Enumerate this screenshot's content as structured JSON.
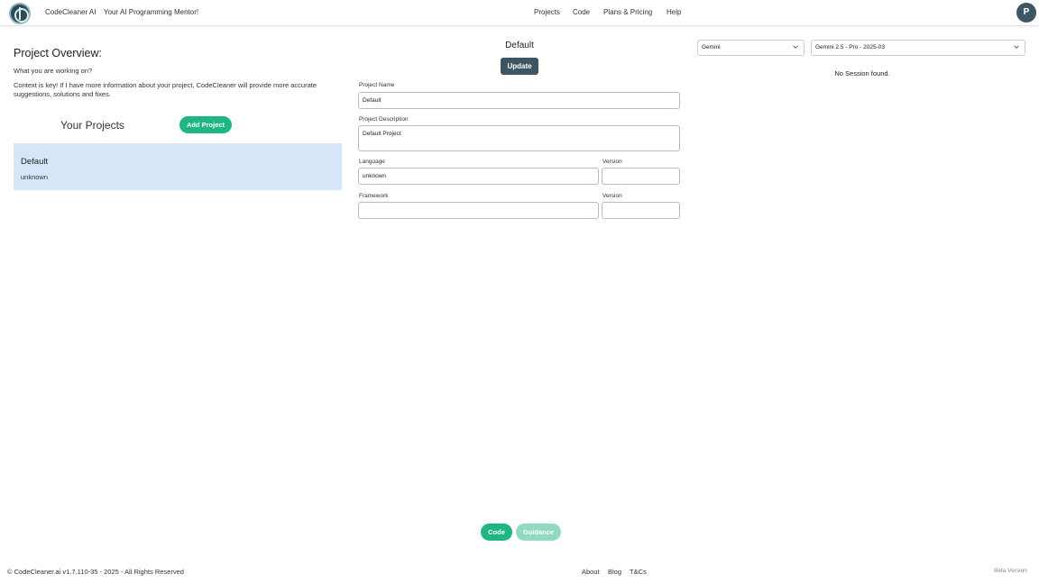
{
  "header": {
    "brand": "CodeCleaner AI",
    "tagline": "Your AI Programming Mentor!",
    "nav": [
      "Projects",
      "Code",
      "Plans & Pricing",
      "Help"
    ],
    "avatar_initial": "P"
  },
  "overview": {
    "title": "Project Overview:",
    "subtitle": "What you are working on?",
    "text": "Context is key! If I have more information about your project, CodeCleaner will provide more accurate suggestions, solutions and fixes."
  },
  "projects": {
    "heading": "Your Projects",
    "add_label": "Add Project",
    "items": [
      {
        "name": "Default",
        "language": "unknown"
      }
    ]
  },
  "form": {
    "title": "Default",
    "update_label": "Update",
    "project_name_label": "Project Name",
    "project_name_value": "Default",
    "description_label": "Project Description",
    "description_value": "Default Project",
    "language_label": "Language",
    "language_value": "unknown",
    "language_version_label": "Version",
    "language_version_value": "",
    "framework_label": "Framework",
    "framework_value": "",
    "framework_version_label": "Version",
    "framework_version_value": ""
  },
  "sessions": {
    "provider": "Gemini",
    "model": "Gemini 2.5 - Pro - 2025-03",
    "empty_text": "No Session found."
  },
  "bottom": {
    "code_label": "Code",
    "guidance_label": "Guidance"
  },
  "footer": {
    "copyright": "© CodeCleaner.ai v1.7.110-35 - 2025 - All Rights Reserved",
    "links": [
      "About",
      "Blog",
      "T&Cs"
    ],
    "beta": "Beta Version"
  },
  "colors": {
    "accent": "#1fb585",
    "accent_disabled": "#8fdac1",
    "dark": "#3e5663",
    "project_card": "#d6e6f8"
  }
}
